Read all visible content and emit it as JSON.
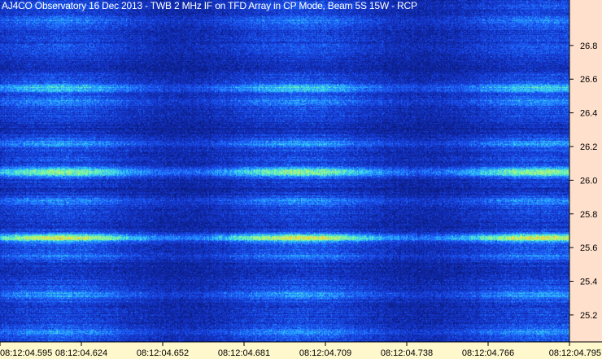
{
  "title": "AJ4CO Observatory 16 Dec 2013 - TWB 2 MHz IF on TFD Array in CP Mode, Beam 5S 15W - RCP",
  "chart_data": {
    "type": "heatmap",
    "title": "AJ4CO Observatory 16 Dec 2013 - TWB 2 MHz IF on TFD Array in CP Mode, Beam 5S 15W - RCP",
    "x": {
      "tick_labels": [
        "08:12:04.595",
        "08:12:04.624",
        "08:12:04.652",
        "08:12:04.681",
        "08:12:04.709",
        "08:12:04.738",
        "08:12:04.766",
        "08:12:04.795"
      ],
      "range": [
        "08:12:04.595",
        "08:12:04.795"
      ]
    },
    "y": {
      "tick_labels": [
        "26.8",
        "26.6",
        "26.4",
        "26.2",
        "26.0",
        "25.8",
        "25.6",
        "25.4",
        "25.2"
      ],
      "tick_values": [
        26.8,
        26.6,
        26.4,
        26.2,
        26.0,
        25.8,
        25.6,
        25.4,
        25.2
      ],
      "range": [
        25.04,
        27.07
      ]
    },
    "axis_side": {
      "y": "right",
      "x": "bottom"
    },
    "colormap": [
      "#0a1a7a",
      "#1432c8",
      "#1e64ff",
      "#2ec8ff",
      "#7dffa0",
      "#ffe135",
      "#ff6a1f"
    ],
    "bright_bands": [
      {
        "freq": 25.66,
        "intensity": 1.0
      },
      {
        "freq": 26.05,
        "intensity": 0.85
      },
      {
        "freq": 26.55,
        "intensity": 0.55
      },
      {
        "freq": 26.22,
        "intensity": 0.4
      },
      {
        "freq": 25.88,
        "intensity": 0.3
      },
      {
        "freq": 26.47,
        "intensity": 0.35
      },
      {
        "freq": 25.55,
        "intensity": 0.25
      },
      {
        "freq": 25.32,
        "intensity": 0.35
      },
      {
        "freq": 25.1,
        "intensity": 0.3
      },
      {
        "freq": 26.95,
        "intensity": 0.25
      }
    ],
    "dark_bands": [
      {
        "freq": 26.68,
        "depth": 0.5
      },
      {
        "freq": 26.32,
        "depth": 0.45
      },
      {
        "freq": 25.95,
        "depth": 0.45
      },
      {
        "freq": 25.75,
        "depth": 0.35
      },
      {
        "freq": 25.47,
        "depth": 0.5
      }
    ]
  }
}
